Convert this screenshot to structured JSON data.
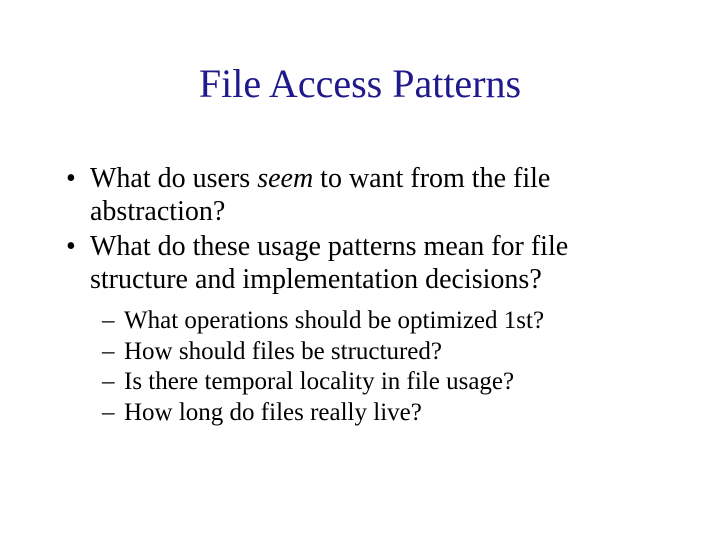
{
  "title": "File Access Patterns",
  "bullets": {
    "b1_pre": "What do users ",
    "b1_em": "seem",
    "b1_post": " to want from the file abstraction?",
    "b2": "What do these usage patterns mean for file structure and implementation decisions?"
  },
  "subbullets": {
    "s1": "What operations should be optimized 1st?",
    "s2": "How should files be structured?",
    "s3": "Is there temporal locality in file usage?",
    "s4": "How long do files really live?"
  }
}
